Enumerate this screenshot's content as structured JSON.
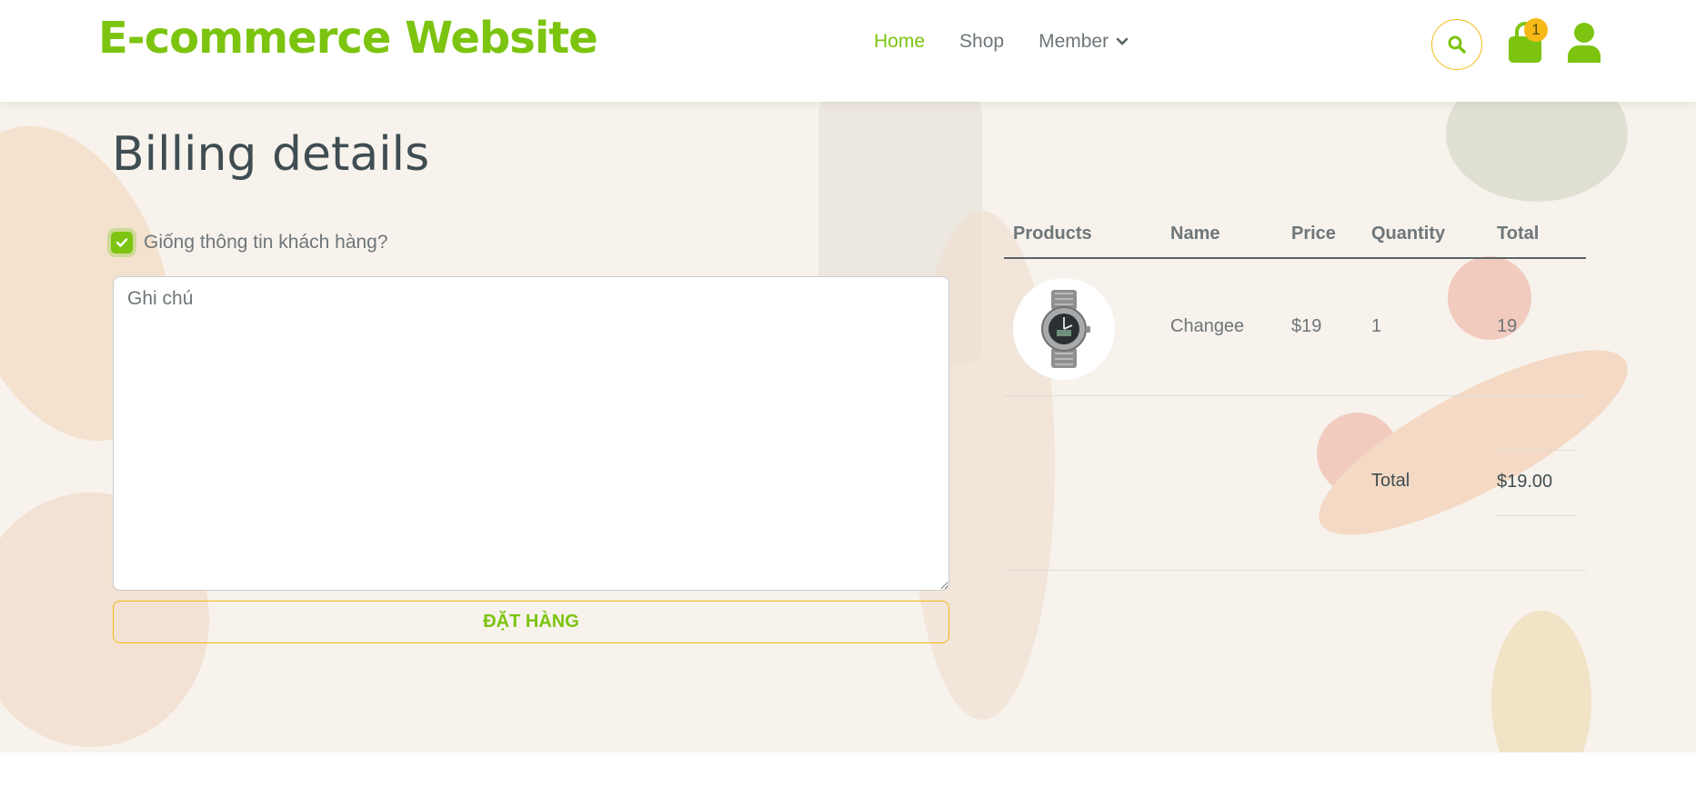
{
  "header": {
    "logo": "E-commerce Website",
    "nav": [
      {
        "label": "Home"
      },
      {
        "label": "Shop"
      },
      {
        "label": "Member"
      }
    ],
    "cart_count": "1"
  },
  "billing": {
    "title": "Billing details",
    "same_info_label": "Giống thông tin khách hàng?",
    "same_info_checked": true,
    "note_placeholder": "Ghi chú",
    "order_button": "ĐẶT HÀNG"
  },
  "table": {
    "headers": [
      "Products",
      "Name",
      "Price",
      "Quantity",
      "Total"
    ],
    "rows": [
      {
        "name": "Changee",
        "price": "$19",
        "quantity": "1",
        "total": "19"
      }
    ],
    "summary": {
      "label": "Total",
      "value": "$19.00"
    }
  },
  "colors": {
    "accent": "#7cc40f",
    "secondary": "#f5b816",
    "heading": "#3f4d52"
  }
}
